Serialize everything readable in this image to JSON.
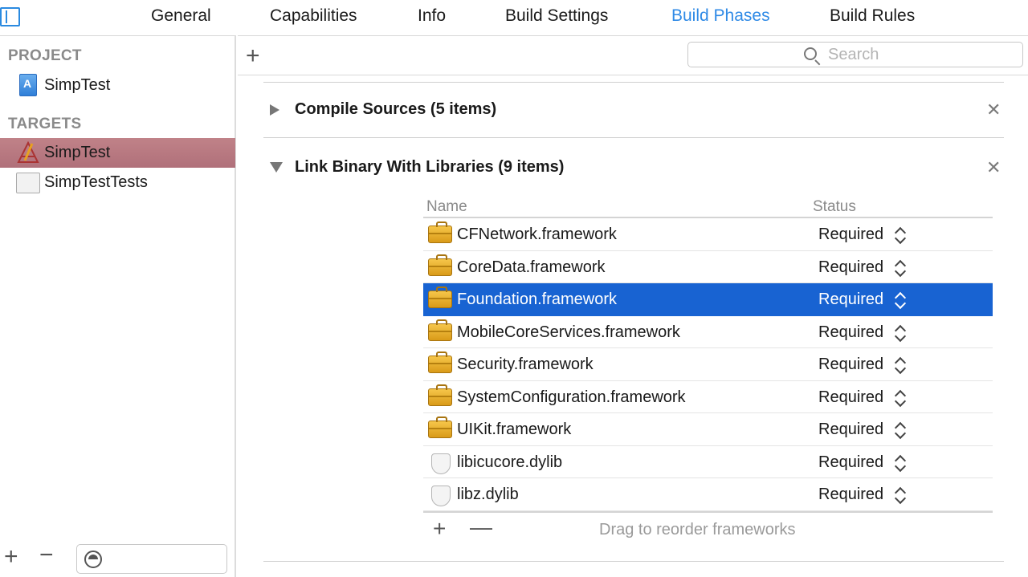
{
  "tabs": [
    {
      "label": "General",
      "active": false
    },
    {
      "label": "Capabilities",
      "active": false
    },
    {
      "label": "Info",
      "active": false
    },
    {
      "label": "Build Settings",
      "active": false
    },
    {
      "label": "Build Phases",
      "active": true
    },
    {
      "label": "Build Rules",
      "active": false
    }
  ],
  "sidebar": {
    "project_header": "PROJECT",
    "project_item": "SimpTest",
    "targets_header": "TARGETS",
    "targets": [
      {
        "label": "SimpTest",
        "selected": true,
        "icon": "app-target-icon"
      },
      {
        "label": "SimpTestTests",
        "selected": false,
        "icon": "test-bundle-icon"
      }
    ],
    "filter_placeholder": ""
  },
  "toolbar": {
    "add_label": "+",
    "search_placeholder": "Search"
  },
  "phases": {
    "compile": {
      "title": "Compile Sources (5 items)",
      "expanded": false,
      "close_label": "✕"
    },
    "link": {
      "title": "Link Binary With Libraries (9 items)",
      "expanded": true,
      "close_label": "✕"
    }
  },
  "library_table": {
    "col_name": "Name",
    "col_status": "Status",
    "rows": [
      {
        "name": "CFNetwork.framework",
        "status": "Required",
        "icon": "framework-toolbox-icon",
        "selected": false
      },
      {
        "name": "CoreData.framework",
        "status": "Required",
        "icon": "framework-toolbox-icon",
        "selected": false
      },
      {
        "name": "Foundation.framework",
        "status": "Required",
        "icon": "framework-toolbox-icon",
        "selected": true
      },
      {
        "name": "MobileCoreServices.framework",
        "status": "Required",
        "icon": "framework-toolbox-icon",
        "selected": false
      },
      {
        "name": "Security.framework",
        "status": "Required",
        "icon": "framework-toolbox-icon",
        "selected": false
      },
      {
        "name": "SystemConfiguration.framework",
        "status": "Required",
        "icon": "framework-toolbox-icon",
        "selected": false
      },
      {
        "name": "UIKit.framework",
        "status": "Required",
        "icon": "framework-toolbox-icon",
        "selected": false
      },
      {
        "name": "libicucore.dylib",
        "status": "Required",
        "icon": "dylib-shield-icon",
        "selected": false
      },
      {
        "name": "libz.dylib",
        "status": "Required",
        "icon": "dylib-shield-icon",
        "selected": false
      }
    ],
    "footer_hint": "Drag to reorder frameworks",
    "add_label": "+",
    "remove_label": "—"
  },
  "colors": {
    "accent": "#2f8ae6",
    "selection": "#1863d2",
    "target_selection": "#b8747c"
  }
}
